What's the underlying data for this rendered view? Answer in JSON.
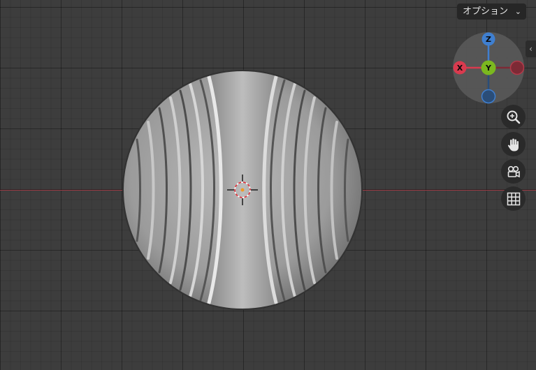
{
  "header": {
    "options_label": "オプション",
    "options_chevron": "⌄"
  },
  "gizmo": {
    "z_label": "Z",
    "y_label": "Y",
    "x_label": "X",
    "colors": {
      "x": "#d93a4e",
      "y": "#7bb81f",
      "z": "#3f7fd0"
    }
  },
  "sidebar": {
    "toggle_glyph": "‹"
  },
  "nav_buttons": {
    "icons": [
      "zoom-icon",
      "pan-hand-icon",
      "camera-icon",
      "grid-icon"
    ]
  },
  "colors": {
    "grid_background": "#3d3d3d",
    "x_axis_line": "#9b3a44",
    "object": "#9a9a9a"
  }
}
